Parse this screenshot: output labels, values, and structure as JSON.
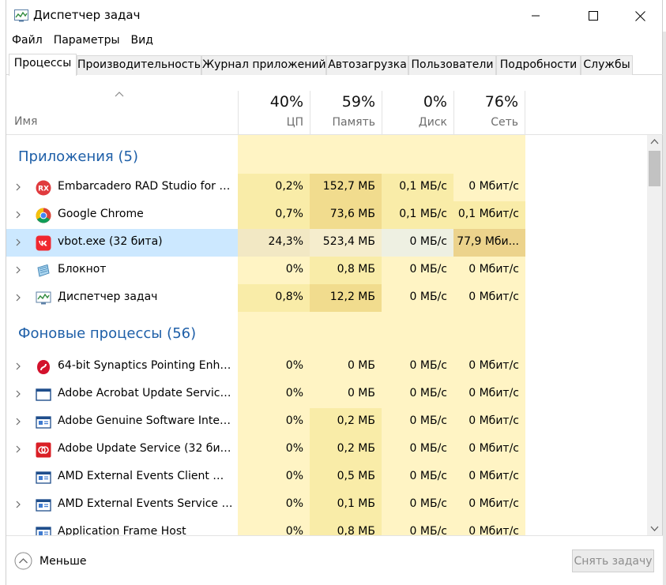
{
  "window": {
    "title": "Диспетчер задач",
    "controls": {
      "minimize": "minimize-icon",
      "maximize": "maximize-icon",
      "close": "close-icon"
    }
  },
  "menu": [
    "Файл",
    "Параметры",
    "Вид"
  ],
  "tabs": [
    {
      "label": "Процессы",
      "active": true
    },
    {
      "label": "Производительность"
    },
    {
      "label": "Журнал приложений"
    },
    {
      "label": "Автозагрузка"
    },
    {
      "label": "Пользователи"
    },
    {
      "label": "Подробности"
    },
    {
      "label": "Службы"
    }
  ],
  "columns": {
    "name": "Имя",
    "cpu": {
      "percent": "40%",
      "label": "ЦП"
    },
    "memory": {
      "percent": "59%",
      "label": "Память"
    },
    "disk": {
      "percent": "0%",
      "label": "Диск"
    },
    "network": {
      "percent": "76%",
      "label": "Сеть"
    }
  },
  "groups": [
    {
      "title": "Приложения (5)",
      "rows": [
        {
          "name": "Embarcadero RAD Studio for W...",
          "icon": "rad-studio-icon",
          "cpu": "0,2%",
          "mem": "152,7 МБ",
          "disk": "0,1 МБ/с",
          "net": "0 Мбит/с",
          "expandable": true
        },
        {
          "name": "Google Chrome",
          "icon": "chrome-icon",
          "cpu": "0,7%",
          "mem": "73,6 МБ",
          "disk": "0,1 МБ/с",
          "net": "0,1 Мбит/с",
          "expandable": true
        },
        {
          "name": "vbot.exe (32 бита)",
          "icon": "vk-icon",
          "cpu": "24,3%",
          "mem": "523,4 МБ",
          "disk": "0 МБ/с",
          "net": "77,9 Мби...",
          "expandable": true,
          "selected": true
        },
        {
          "name": "Блокнот",
          "icon": "notepad-icon",
          "cpu": "0%",
          "mem": "0,8 МБ",
          "disk": "0 МБ/с",
          "net": "0 Мбит/с",
          "expandable": true
        },
        {
          "name": "Диспетчер задач",
          "icon": "task-manager-icon",
          "cpu": "0,8%",
          "mem": "12,2 МБ",
          "disk": "0 МБ/с",
          "net": "0 Мбит/с",
          "expandable": true
        }
      ]
    },
    {
      "title": "Фоновые процессы (56)",
      "rows": [
        {
          "name": "64-bit Synaptics Pointing Enhan...",
          "icon": "synaptics-icon",
          "cpu": "0%",
          "mem": "0 МБ",
          "disk": "0 МБ/с",
          "net": "0 Мбит/с",
          "expandable": true
        },
        {
          "name": "Adobe Acrobat Update Service ...",
          "icon": "service-window-icon",
          "cpu": "0%",
          "mem": "0 МБ",
          "disk": "0 МБ/с",
          "net": "0 Мбит/с",
          "expandable": true
        },
        {
          "name": "Adobe Genuine Software Integr...",
          "icon": "service-app-icon",
          "cpu": "0%",
          "mem": "0,2 МБ",
          "disk": "0 МБ/с",
          "net": "0 Мбит/с",
          "expandable": true
        },
        {
          "name": "Adobe Update Service (32 бита)",
          "icon": "adobe-cc-icon",
          "cpu": "0%",
          "mem": "0,2 МБ",
          "disk": "0 МБ/с",
          "net": "0 Мбит/с",
          "expandable": true
        },
        {
          "name": "AMD External Events Client Mo...",
          "icon": "service-app-icon",
          "cpu": "0%",
          "mem": "0,5 МБ",
          "disk": "0 МБ/с",
          "net": "0 Мбит/с",
          "expandable": false
        },
        {
          "name": "AMD External Events Service M...",
          "icon": "service-app-icon",
          "cpu": "0%",
          "mem": "0,1 МБ",
          "disk": "0 МБ/с",
          "net": "0 Мбит/с",
          "expandable": true
        },
        {
          "name": "Application Frame Host",
          "icon": "service-app-icon",
          "cpu": "0%",
          "mem": "0,8 МБ",
          "disk": "0 МБ/с",
          "net": "0 Мбит/с",
          "expandable": false
        }
      ]
    }
  ],
  "footer": {
    "less_label": "Меньше",
    "end_task_label": "Снять задачу"
  },
  "colors": {
    "heat_light": "#fff4c4",
    "heat_medium": "#f9eca8",
    "heat_strong": "#f1dc8e",
    "group_title": "#1e5fa8",
    "selected": "#cce8ff"
  }
}
